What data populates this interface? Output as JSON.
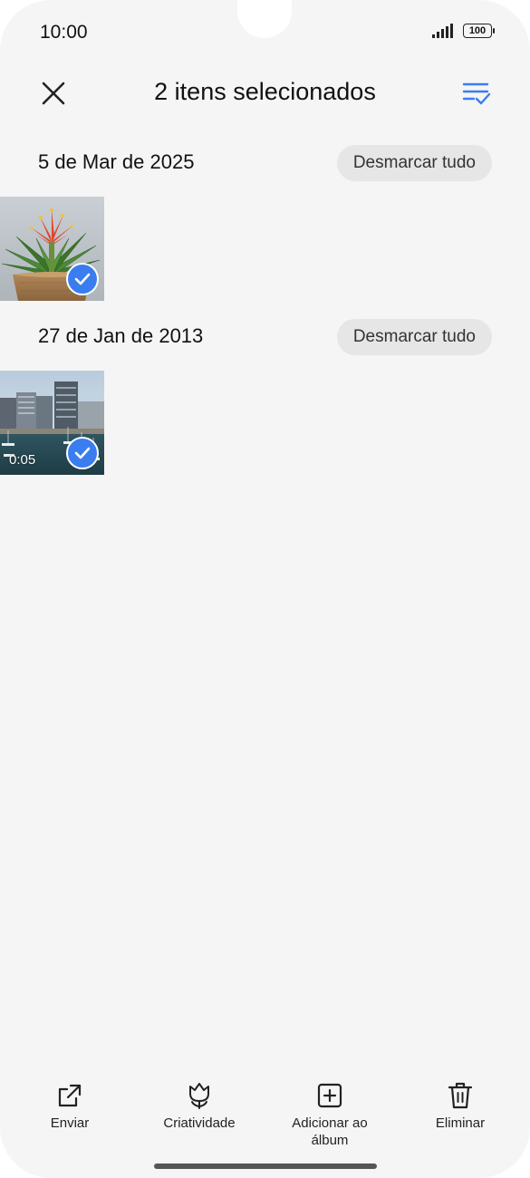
{
  "status_bar": {
    "time": "10:00",
    "battery": "100",
    "signal_icon": "signal-bars-icon"
  },
  "header": {
    "title": "2 itens selecionados",
    "close_icon": "close-icon",
    "select_all_icon": "select-all-list-icon",
    "accent_color": "#3a7df0"
  },
  "groups": [
    {
      "date": "5 de Mar de 2025",
      "deselect_label": "Desmarcar tudo",
      "items": [
        {
          "type": "photo",
          "subject": "bromeliad-plant",
          "selected": true
        }
      ]
    },
    {
      "date": "27 de Jan de 2013",
      "deselect_label": "Desmarcar tudo",
      "items": [
        {
          "type": "video",
          "subject": "harbor-buildings",
          "duration": "0:05",
          "selected": true
        }
      ]
    }
  ],
  "bottom_actions": [
    {
      "label": "Enviar",
      "icon": "share-icon"
    },
    {
      "label": "Criatividade",
      "icon": "tulip-icon"
    },
    {
      "label": "Adicionar ao álbum",
      "icon": "add-to-album-icon"
    },
    {
      "label": "Eliminar",
      "icon": "trash-icon"
    }
  ]
}
